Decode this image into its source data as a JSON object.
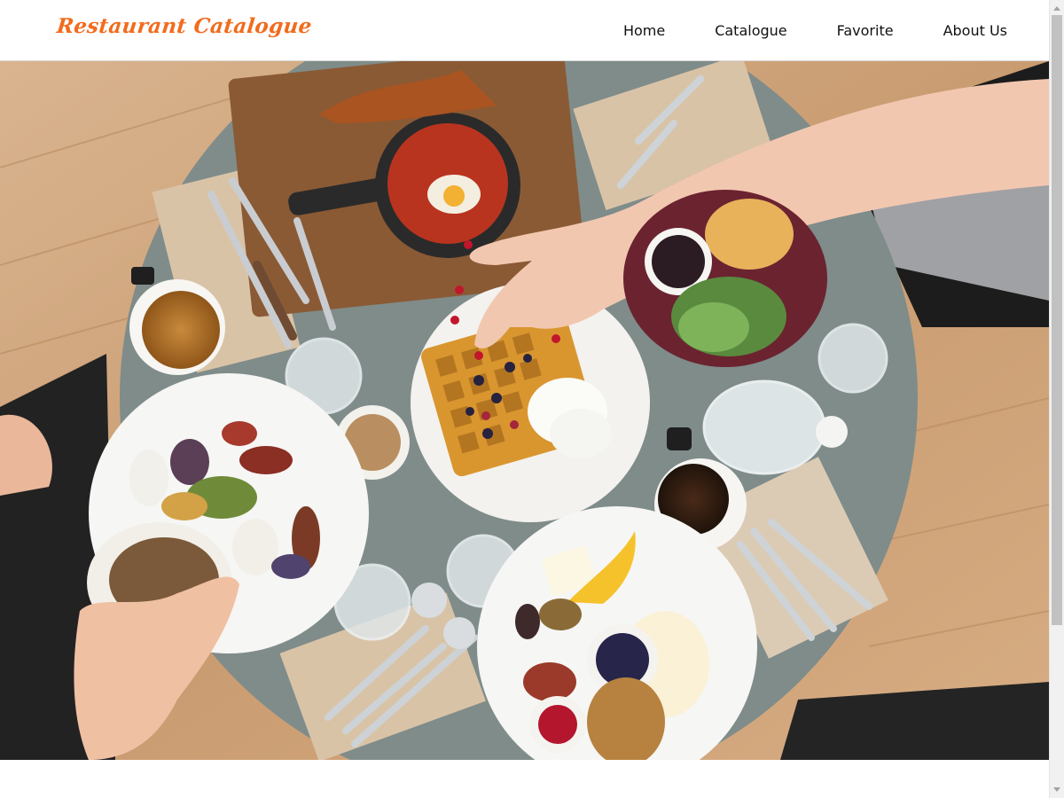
{
  "header": {
    "brand": "Restaurant  Catalogue",
    "nav": [
      {
        "label": "Home"
      },
      {
        "label": "Catalogue"
      },
      {
        "label": "Favorite"
      },
      {
        "label": "About Us"
      }
    ]
  },
  "hero": {
    "image": "hero-image-food-table"
  },
  "colors": {
    "brand": "#f26b1d",
    "nav_text": "#111111"
  }
}
